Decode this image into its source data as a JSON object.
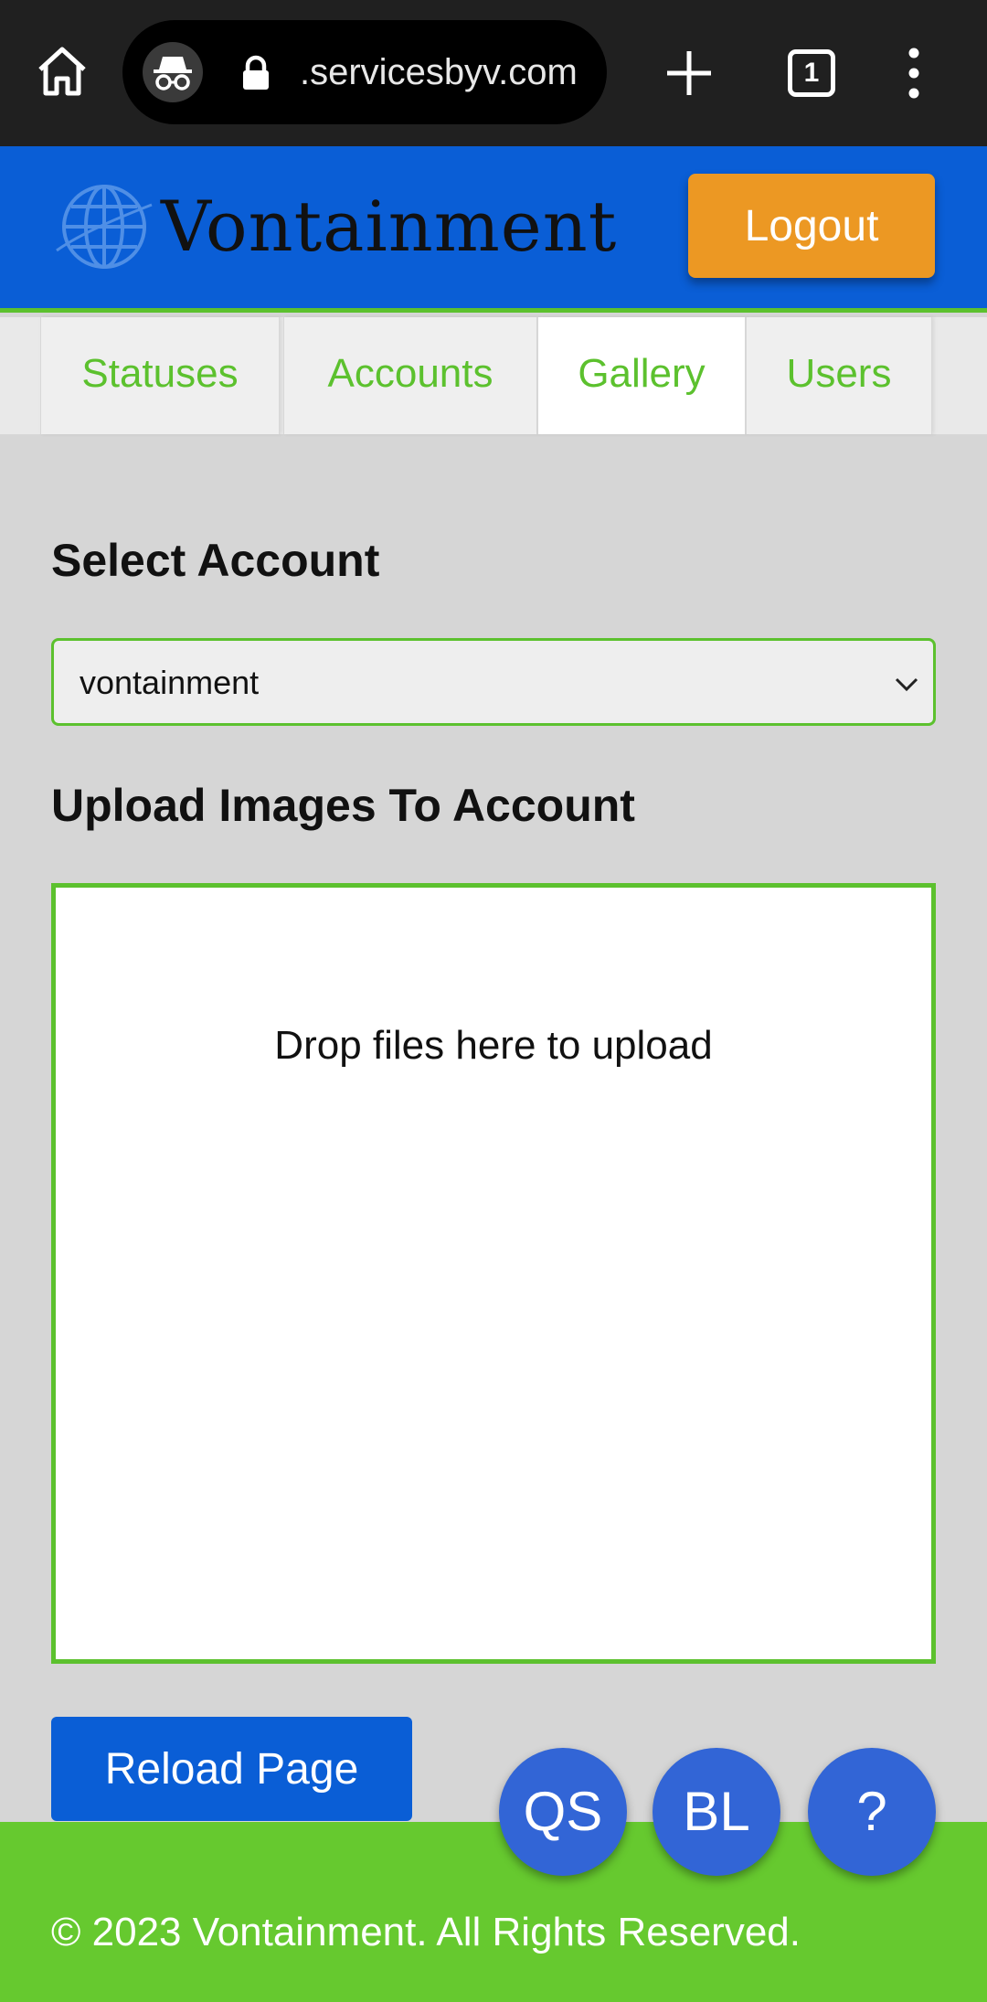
{
  "browser": {
    "url": ".servicesbyv.com",
    "tab_count": "1",
    "icons": [
      "home-icon",
      "incognito-icon",
      "lock-icon",
      "new-tab-icon",
      "tab-switcher-icon",
      "more-menu-icon"
    ]
  },
  "header": {
    "brand": "Vontainment",
    "logout_label": "Logout"
  },
  "tabs": [
    {
      "label": "Statuses",
      "active": false
    },
    {
      "label": "Accounts",
      "active": false
    },
    {
      "label": "Gallery",
      "active": true
    },
    {
      "label": "Users",
      "active": false
    }
  ],
  "main": {
    "select_heading": "Select Account",
    "selected_account": "vontainment",
    "upload_heading": "Upload Images To Account",
    "dropzone_message": "Drop files here to upload",
    "reload_label": "Reload Page"
  },
  "fabs": [
    {
      "label": "QS"
    },
    {
      "label": "BL"
    },
    {
      "label": "?"
    }
  ],
  "footer": {
    "text": "© 2023 Vontainment. All Rights Reserved."
  },
  "colors": {
    "brand_blue": "#0a5ed6",
    "accent_green": "#5cc12e",
    "logout_orange": "#ec9823",
    "fab_blue": "#3265d6"
  }
}
